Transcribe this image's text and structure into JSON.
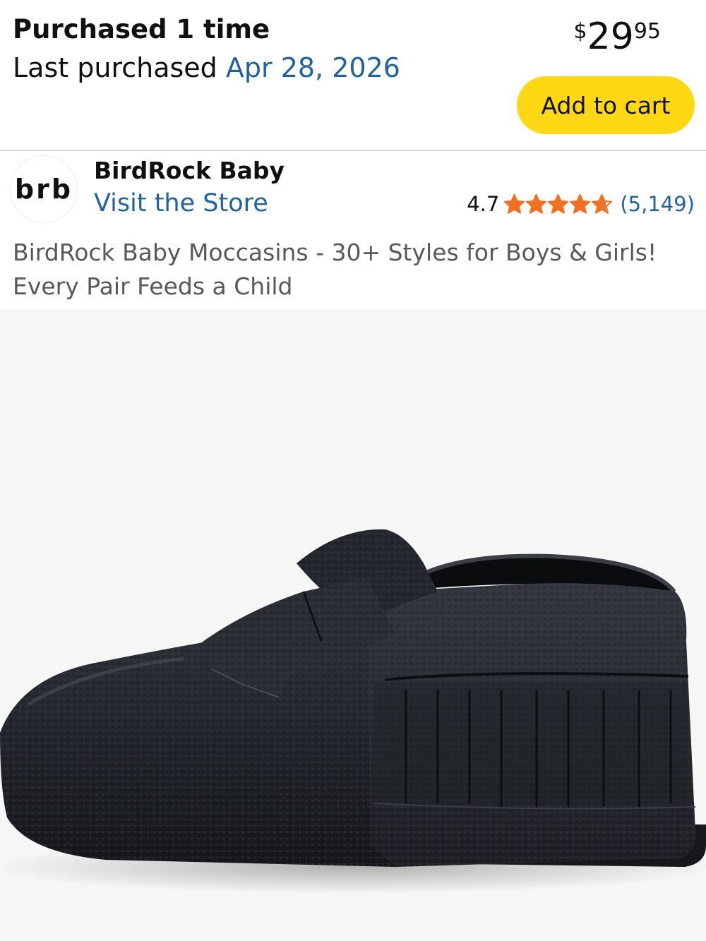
{
  "purchase": {
    "count_label": "Purchased 1 time",
    "last_label": "Last purchased",
    "last_date": "Apr 28, 2026"
  },
  "price": {
    "symbol": "$",
    "whole": "29",
    "fraction": "95"
  },
  "cart": {
    "label": "Add to cart",
    "button_color": "#ffd814"
  },
  "brand": {
    "logo_text": "brb",
    "name": "BirdRock Baby",
    "store_link": "Visit the Store"
  },
  "rating": {
    "value": "4.7",
    "stars": 4.7,
    "max_stars": 5,
    "review_count": "(5,149)",
    "star_color": "#f27022"
  },
  "product": {
    "title": "BirdRock Baby Moccasins - 30+ Styles for Boys & Girls! Every Pair Feeds a Child",
    "image": "black-leather-baby-moccasin-photo"
  },
  "colors": {
    "link": "#2162a1",
    "text": "#0f1111",
    "muted_text": "#565959",
    "divider": "#d5d9d9"
  }
}
